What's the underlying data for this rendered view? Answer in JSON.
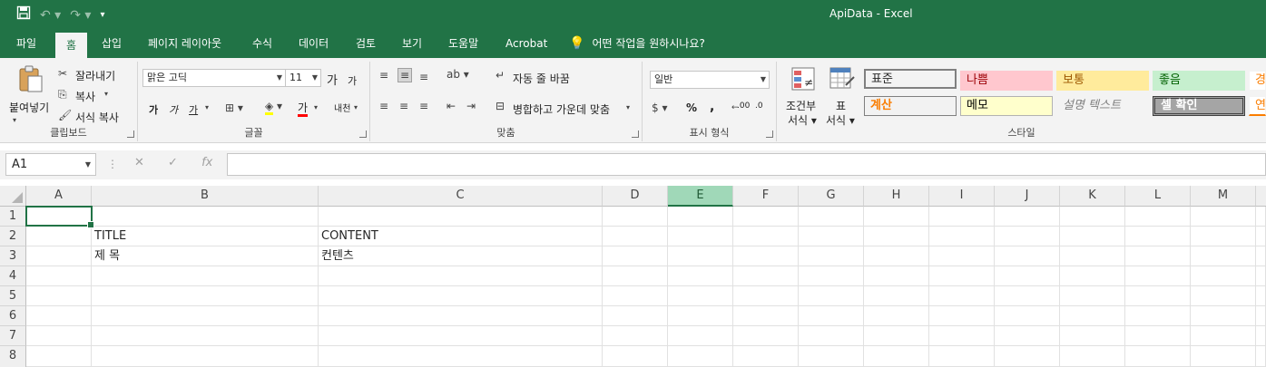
{
  "window": {
    "app_title": "ApiData  -  Excel"
  },
  "qat": {
    "save_icon": "save-icon",
    "undo_icon": "undo-icon",
    "redo_icon": "redo-icon",
    "customize_icon": "customize-qat-icon"
  },
  "tabs": [
    "파일",
    "홈",
    "삽입",
    "페이지 레이아웃",
    "수식",
    "데이터",
    "검토",
    "보기",
    "도움말",
    "Acrobat"
  ],
  "active_tab": "홈",
  "tell_me": "어떤 작업을 원하시나요?",
  "clipboard": {
    "paste": "붙여넣기",
    "cut": "잘라내기",
    "copy": "복사",
    "format_painter": "서식 복사",
    "label": "클립보드"
  },
  "font": {
    "name": "맑은 고딕",
    "size": "11",
    "grow": "가",
    "shrink": "가",
    "bold": "가",
    "italic": "가",
    "underline": "가",
    "font_color": "가",
    "phonetic": "내천",
    "label": "글꼴"
  },
  "alignment": {
    "wrap": "자동 줄 바꿈",
    "merge": "병합하고 가운데 맞춤",
    "label": "맞춤"
  },
  "number": {
    "format": "일반",
    "percent": "%",
    "comma": ",",
    "inc_decimal": ".00",
    "dec_decimal": ".0",
    "label": "표시 형식"
  },
  "styles": {
    "conditional": [
      "조건부",
      "서식"
    ],
    "table": [
      "표",
      "서식"
    ],
    "items": [
      {
        "label": "표준",
        "bg": "#ffffff",
        "color": "#000000"
      },
      {
        "label": "나쁨",
        "bg": "#ffc7ce",
        "color": "#9c0006"
      },
      {
        "label": "보통",
        "bg": "#ffeb9c",
        "color": "#9c5700"
      },
      {
        "label": "좋음",
        "bg": "#c6efce",
        "color": "#006100"
      },
      {
        "label": "경",
        "bg": "#ffffff",
        "color": "#fa7d00"
      },
      {
        "label": "계산",
        "bg": "#f2f2f2",
        "color": "#fa7d00"
      },
      {
        "label": "메모",
        "bg": "#ffffcc",
        "color": "#000000"
      },
      {
        "label": "설명 텍스트",
        "bg": "#f3f3f3",
        "color": "#7f7f7f"
      },
      {
        "label": "셀 확인",
        "bg": "#a5a5a5",
        "color": "#ffffff"
      },
      {
        "label": "연",
        "bg": "#ffffff",
        "color": "#fa7d00"
      }
    ],
    "label": "스타일"
  },
  "formula_bar": {
    "name_box": "A1",
    "cancel": "✕",
    "enter": "✓",
    "fx": "fx",
    "value": ""
  },
  "columns": [
    "A",
    "B",
    "C",
    "D",
    "E",
    "F",
    "G",
    "H",
    "I",
    "J",
    "K",
    "L",
    "M"
  ],
  "selected_column": "E",
  "rows": [
    "1",
    "2",
    "3",
    "4",
    "5",
    "6",
    "7",
    "8"
  ],
  "cells": [
    [
      "",
      "",
      ""
    ],
    [
      "",
      "TITLE",
      "CONTENT"
    ],
    [
      "",
      "제 목",
      "컨텐츠"
    ],
    [
      "",
      "",
      ""
    ],
    [
      "",
      "",
      ""
    ],
    [
      "",
      "",
      ""
    ],
    [
      "",
      "",
      ""
    ],
    [
      "",
      "",
      ""
    ]
  ]
}
